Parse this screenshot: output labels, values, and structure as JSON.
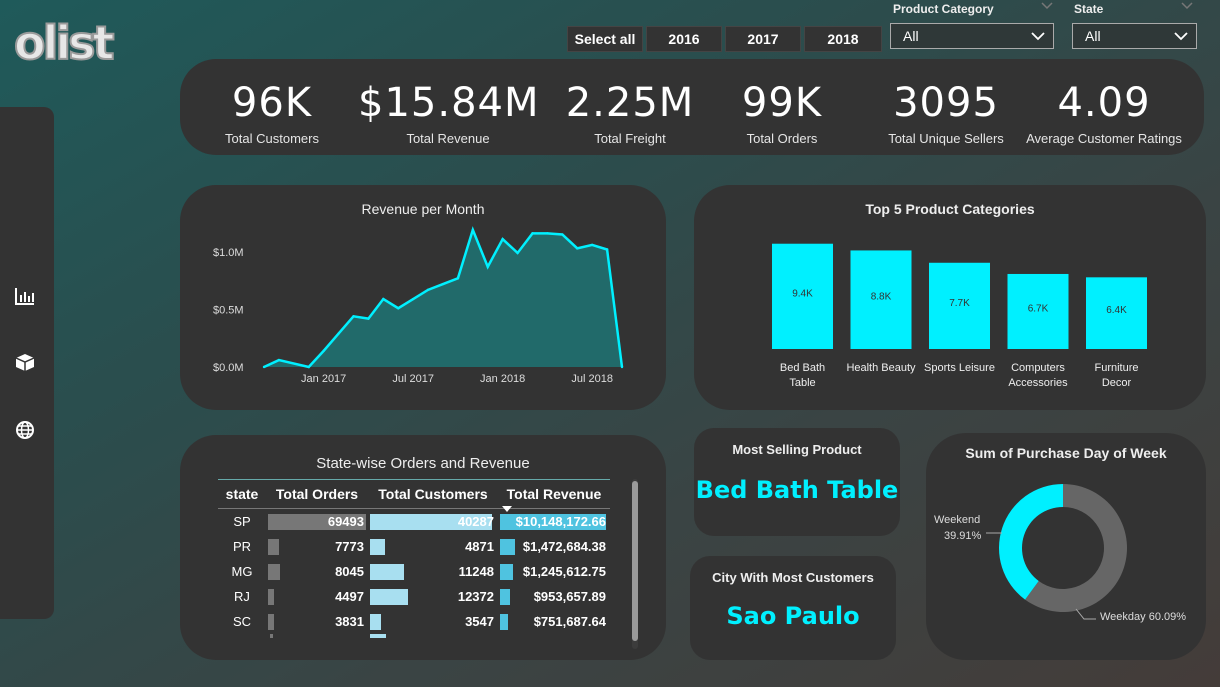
{
  "logo": "olist",
  "sidebar": {
    "icons": [
      "bar-chart-icon",
      "box-icon",
      "globe-icon"
    ]
  },
  "year_buttons": [
    "Select all",
    "2016",
    "2017",
    "2018"
  ],
  "slicers": {
    "category": {
      "label": "Product Category",
      "value": "All"
    },
    "state": {
      "label": "State",
      "value": "All"
    }
  },
  "kpis": [
    {
      "value": "96K",
      "label": "Total Customers"
    },
    {
      "value": "$15.84M",
      "label": "Total Revenue"
    },
    {
      "value": "2.25M",
      "label": "Total Freight"
    },
    {
      "value": "99K",
      "label": "Total Orders"
    },
    {
      "value": "3095",
      "label": "Total Unique Sellers"
    },
    {
      "value": "4.09",
      "label": "Average Customer Ratings"
    }
  ],
  "revenue_chart": {
    "title": "Revenue per Month"
  },
  "categories_chart": {
    "title": "Top 5 Product Categories"
  },
  "table": {
    "title": "State-wise Orders and Revenue",
    "headers": [
      "state",
      "Total Orders",
      "Total Customers",
      "Total Revenue"
    ],
    "rows": [
      {
        "state": "SP",
        "orders": "69493",
        "customers": "40287",
        "revenue": "$10,148,172.66"
      },
      {
        "state": "PR",
        "orders": "7773",
        "customers": "4871",
        "revenue": "$1,472,684.38"
      },
      {
        "state": "MG",
        "orders": "8045",
        "customers": "11248",
        "revenue": "$1,245,612.75"
      },
      {
        "state": "RJ",
        "orders": "4497",
        "customers": "12372",
        "revenue": "$953,657.89"
      },
      {
        "state": "SC",
        "orders": "3831",
        "customers": "3547",
        "revenue": "$751,687.64"
      }
    ],
    "bar_fractions": {
      "orders": [
        1.0,
        0.11,
        0.12,
        0.065,
        0.055
      ],
      "customers": [
        1.0,
        0.12,
        0.28,
        0.31,
        0.088
      ],
      "revenue": [
        1.0,
        0.145,
        0.123,
        0.094,
        0.074
      ]
    }
  },
  "most_selling": {
    "title": "Most Selling Product",
    "value": "Bed Bath Table"
  },
  "top_city": {
    "title": "City With Most Customers",
    "value": "Sao Paulo"
  },
  "donut_chart": {
    "title": "Sum of Purchase Day of Week"
  },
  "colors": {
    "accent": "#00f0ff",
    "panel": "#333333",
    "grey": "#666666",
    "light_blue": "#a8dff0",
    "mid_blue": "#4fc3e0"
  },
  "chart_data": [
    {
      "type": "area",
      "title": "Revenue per Month",
      "x": [
        "2016-09",
        "2016-10",
        "2016-12",
        "2017-01",
        "2017-02",
        "2017-03",
        "2017-04",
        "2017-05",
        "2017-06",
        "2017-07",
        "2017-08",
        "2017-09",
        "2017-10",
        "2017-11",
        "2017-12",
        "2018-01",
        "2018-02",
        "2018-03",
        "2018-04",
        "2018-05",
        "2018-06",
        "2018-07",
        "2018-08",
        "2018-09"
      ],
      "values": [
        0.0,
        0.06,
        0.0,
        0.14,
        0.29,
        0.44,
        0.42,
        0.59,
        0.51,
        0.59,
        0.67,
        0.72,
        0.77,
        1.19,
        0.87,
        1.11,
        0.99,
        1.16,
        1.16,
        1.15,
        1.03,
        1.06,
        1.02,
        0.0
      ],
      "xticks": [
        "Jan 2017",
        "Jul 2017",
        "Jan 2018",
        "Jul 2018"
      ],
      "yticks": [
        "$0.0M",
        "$0.5M",
        "$1.0M"
      ],
      "ylim": [
        0,
        1.25
      ],
      "xlabel": "",
      "ylabel": ""
    },
    {
      "type": "bar",
      "title": "Top 5 Product Categories",
      "categories": [
        "Bed Bath Table",
        "Health Beauty",
        "Sports Leisure",
        "Computers Accessories",
        "Furniture Decor"
      ],
      "category_lines": [
        [
          "Bed Bath",
          "Table"
        ],
        [
          "Health Beauty"
        ],
        [
          "Sports Leisure"
        ],
        [
          "Computers",
          "Accessories"
        ],
        [
          "Furniture",
          "Decor"
        ]
      ],
      "values": [
        9.4,
        8.8,
        7.7,
        6.7,
        6.4
      ],
      "value_labels": [
        "9.4K",
        "8.8K",
        "7.7K",
        "6.7K",
        "6.4K"
      ],
      "ylim": [
        0,
        10
      ]
    },
    {
      "type": "pie",
      "title": "Sum of Purchase Day of Week",
      "slices": [
        {
          "name": "Weekend",
          "value": 39.91,
          "label": "39.91%",
          "color": "#00f0ff"
        },
        {
          "name": "Weekday",
          "value": 60.09,
          "label": "60.09%",
          "color": "#666666"
        }
      ]
    }
  ]
}
